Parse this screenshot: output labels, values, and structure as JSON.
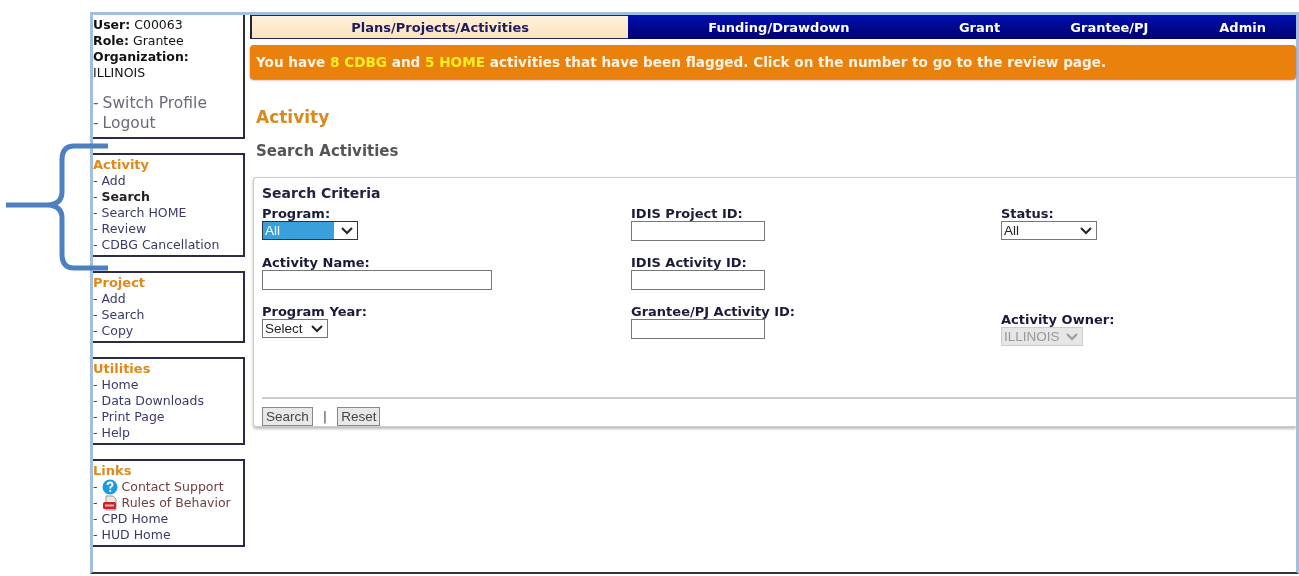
{
  "user_info": {
    "user_label": "User:",
    "user": "C00063",
    "role_label": "Role:",
    "role": "Grantee",
    "org_label": "Organization:",
    "org": "ILLINOIS"
  },
  "profile_links": [
    {
      "bullet": "-",
      "label": "Switch Profile"
    },
    {
      "bullet": "-",
      "label": "Logout"
    }
  ],
  "sidebar": [
    {
      "title": "Activity",
      "items": [
        {
          "bullet": "-",
          "label": "Add",
          "selected": false
        },
        {
          "bullet": "-",
          "label": "Search",
          "selected": true
        },
        {
          "bullet": "-",
          "label": "Search HOME",
          "selected": false
        },
        {
          "bullet": "-",
          "label": "Review",
          "selected": false
        },
        {
          "bullet": "-",
          "label": "CDBG Cancellation",
          "selected": false
        }
      ]
    },
    {
      "title": "Project",
      "items": [
        {
          "bullet": "-",
          "label": "Add",
          "selected": false
        },
        {
          "bullet": "-",
          "label": "Search",
          "selected": false
        },
        {
          "bullet": "-",
          "label": "Copy",
          "selected": false
        }
      ]
    },
    {
      "title": "Utilities",
      "items": [
        {
          "bullet": "-",
          "label": "Home",
          "selected": false
        },
        {
          "bullet": "-",
          "label": "Data Downloads",
          "selected": false
        },
        {
          "bullet": "-",
          "label": "Print Page",
          "selected": false
        },
        {
          "bullet": "-",
          "label": "Help",
          "selected": false
        }
      ]
    },
    {
      "title": "Links",
      "items": [
        {
          "bullet": "-",
          "label": "Contact Support",
          "selected": false,
          "kind": "help"
        },
        {
          "bullet": "-",
          "label": "Rules of Behavior",
          "selected": false,
          "kind": "pdf"
        },
        {
          "bullet": "-",
          "label": "CPD Home",
          "selected": false
        },
        {
          "bullet": "-",
          "label": "HUD Home",
          "selected": false
        }
      ]
    }
  ],
  "tabs": [
    {
      "label": "Plans/Projects/Activities",
      "selected": true
    },
    {
      "label": "Funding/Drawdown",
      "selected": false
    },
    {
      "label": "Grant",
      "selected": false
    },
    {
      "label": "Grantee/PJ",
      "selected": false
    },
    {
      "label": "Admin",
      "selected": false
    }
  ],
  "alert": [
    {
      "kind": "plain",
      "text": "You have "
    },
    {
      "kind": "count",
      "text": "8 CDBG"
    },
    {
      "kind": "plain",
      "text": " and "
    },
    {
      "kind": "count",
      "text": "5 HOME"
    },
    {
      "kind": "plain",
      "text": " activities that have been flagged. Click on the number to go to the review page."
    }
  ],
  "heading": "Activity",
  "subheading": "Search Activities",
  "search_panel": {
    "title": "Search Criteria",
    "rows": [
      [
        {
          "label": "Program:",
          "kind": "select",
          "value": "All",
          "highlighted": true,
          "disabled": false
        },
        {
          "label": "IDIS Project ID:",
          "kind": "text"
        },
        {
          "label": "Status:",
          "kind": "select",
          "value": "All",
          "highlighted": false,
          "disabled": false
        }
      ],
      [
        {
          "label": "Activity Name:",
          "kind": "text"
        },
        {
          "label": "IDIS Activity ID:",
          "kind": "text"
        }
      ],
      [
        {
          "label": "Program Year:",
          "kind": "select",
          "value": "Select",
          "highlighted": false,
          "disabled": false
        },
        {
          "label": "Grantee/PJ Activity ID:",
          "kind": "text"
        },
        {
          "label": "Activity Owner:",
          "kind": "select",
          "value": "ILLINOIS",
          "highlighted": false,
          "disabled": true
        }
      ]
    ],
    "buttons": [
      "Search",
      "Reset"
    ],
    "separator": "|"
  }
}
